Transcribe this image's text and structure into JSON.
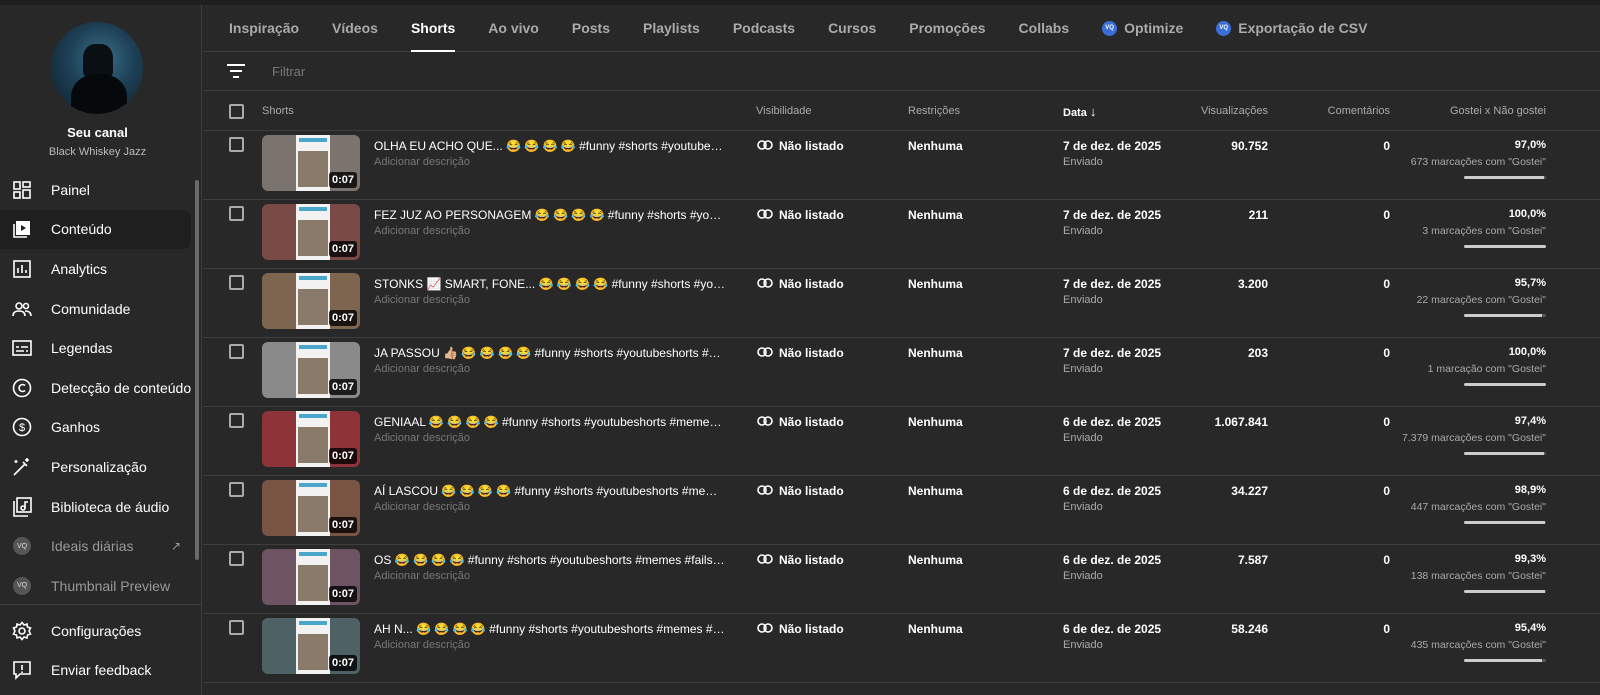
{
  "channel": {
    "name": "Seu canal",
    "subtitle": "Black Whiskey Jazz"
  },
  "nav": [
    {
      "label": "Painel",
      "icon": "dashboard-icon"
    },
    {
      "label": "Conteúdo",
      "icon": "content-icon",
      "active": true
    },
    {
      "label": "Analytics",
      "icon": "analytics-icon"
    },
    {
      "label": "Comunidade",
      "icon": "community-icon"
    },
    {
      "label": "Legendas",
      "icon": "subtitles-icon"
    },
    {
      "label": "Detecção de conteúdo",
      "icon": "copyright-icon"
    },
    {
      "label": "Ganhos",
      "icon": "dollar-icon"
    },
    {
      "label": "Personalização",
      "icon": "magic-wand-icon"
    },
    {
      "label": "Biblioteca de áudio",
      "icon": "audio-library-icon"
    },
    {
      "label": "Ideais diárias",
      "icon": "extension-icon",
      "dim": true,
      "external": true
    },
    {
      "label": "Thumbnail Preview",
      "icon": "extension-icon",
      "dim": true
    }
  ],
  "bottom_nav": [
    {
      "label": "Configurações",
      "icon": "gear-icon"
    },
    {
      "label": "Enviar feedback",
      "icon": "feedback-icon"
    }
  ],
  "extension_badge": "VQ",
  "tabs": [
    {
      "label": "Inspiração"
    },
    {
      "label": "Vídeos"
    },
    {
      "label": "Shorts",
      "active": true
    },
    {
      "label": "Ao vivo"
    },
    {
      "label": "Posts"
    },
    {
      "label": "Playlists"
    },
    {
      "label": "Podcasts"
    },
    {
      "label": "Cursos"
    },
    {
      "label": "Promoções"
    },
    {
      "label": "Collabs"
    },
    {
      "label": "Optimize",
      "badge": true
    },
    {
      "label": "Exportação de CSV",
      "badge": true
    }
  ],
  "filter": {
    "placeholder": "Filtrar"
  },
  "columns": {
    "shorts": "Shorts",
    "visibility": "Visibilidade",
    "restrictions": "Restrições",
    "date": "Data",
    "views": "Visualizações",
    "comments": "Comentários",
    "likes": "Gostei x Não gostei"
  },
  "accent": "#3b6fd8",
  "rows": [
    {
      "title": "OLHA EU ACHO QUE... 😂 😂 😂 😂 #funny #shorts #youtubeshorts #memes",
      "desc": "Adicionar descrição",
      "duration": "0:07",
      "visibility": "Não listado",
      "restrictions": "Nenhuma",
      "date": "7 de dez. de 2025",
      "status": "Enviado",
      "views": "90.752",
      "comments": "0",
      "like_pct": "97,0%",
      "like_ratio": 0.97,
      "likes": "673 marcações com \"Gostei\"",
      "thumb_color": "#7b746e"
    },
    {
      "title": "FEZ JUZ AO PERSONAGEM 😂 😂 😂 😂 #funny #shorts #youtubeshorts #memes",
      "desc": "Adicionar descrição",
      "duration": "0:07",
      "visibility": "Não listado",
      "restrictions": "Nenhuma",
      "date": "7 de dez. de 2025",
      "status": "Enviado",
      "views": "211",
      "comments": "0",
      "like_pct": "100,0%",
      "like_ratio": 1.0,
      "likes": "3 marcações com \"Gostei\"",
      "thumb_color": "#7a4a46"
    },
    {
      "title": "STONKS 📈 SMART, FONE... 😂 😂 😂 😂 #funny #shorts #youtubeshorts #memes",
      "desc": "Adicionar descrição",
      "duration": "0:07",
      "visibility": "Não listado",
      "restrictions": "Nenhuma",
      "date": "7 de dez. de 2025",
      "status": "Enviado",
      "views": "3.200",
      "comments": "0",
      "like_pct": "95,7%",
      "like_ratio": 0.957,
      "likes": "22 marcações com \"Gostei\"",
      "thumb_color": "#7d6550"
    },
    {
      "title": "JA PASSOU 👍🏼 😂 😂 😂 😂 #funny #shorts #youtubeshorts #memes #fails",
      "desc": "Adicionar descrição",
      "duration": "0:07",
      "visibility": "Não listado",
      "restrictions": "Nenhuma",
      "date": "7 de dez. de 2025",
      "status": "Enviado",
      "views": "203",
      "comments": "0",
      "like_pct": "100,0%",
      "like_ratio": 1.0,
      "likes": "1 marcação com \"Gostei\"",
      "thumb_color": "#8a8a8a"
    },
    {
      "title": "GENIAAL 😂 😂 😂 😂 #funny #shorts #youtubeshorts #memes #fails #viral",
      "desc": "Adicionar descrição",
      "duration": "0:07",
      "visibility": "Não listado",
      "restrictions": "Nenhuma",
      "date": "6 de dez. de 2025",
      "status": "Enviado",
      "views": "1.067.841",
      "comments": "0",
      "like_pct": "97,4%",
      "like_ratio": 0.974,
      "likes": "7.379 marcações com \"Gostei\"",
      "thumb_color": "#8e3438"
    },
    {
      "title": "AÍ LASCOU 😂 😂 😂 😂 #funny #shorts #youtubeshorts #memes #fails #viral",
      "desc": "Adicionar descrição",
      "duration": "0:07",
      "visibility": "Não listado",
      "restrictions": "Nenhuma",
      "date": "6 de dez. de 2025",
      "status": "Enviado",
      "views": "34.227",
      "comments": "0",
      "like_pct": "98,9%",
      "like_ratio": 0.989,
      "likes": "447 marcações com \"Gostei\"",
      "thumb_color": "#7a5443"
    },
    {
      "title": "OS 😂 😂 😂 😂 #funny #shorts #youtubeshorts #memes #fails #viralvideo",
      "desc": "Adicionar descrição",
      "duration": "0:07",
      "visibility": "Não listado",
      "restrictions": "Nenhuma",
      "date": "6 de dez. de 2025",
      "status": "Enviado",
      "views": "7.587",
      "comments": "0",
      "like_pct": "99,3%",
      "like_ratio": 0.993,
      "likes": "138 marcações com \"Gostei\"",
      "thumb_color": "#6e5462"
    },
    {
      "title": "AH N... 😂 😂 😂 😂 #funny #shorts #youtubeshorts #memes #fails #viral",
      "desc": "Adicionar descrição",
      "duration": "0:07",
      "visibility": "Não listado",
      "restrictions": "Nenhuma",
      "date": "6 de dez. de 2025",
      "status": "Enviado",
      "views": "58.246",
      "comments": "0",
      "like_pct": "95,4%",
      "like_ratio": 0.954,
      "likes": "435 marcações com \"Gostei\"",
      "thumb_color": "#4e6266"
    }
  ]
}
